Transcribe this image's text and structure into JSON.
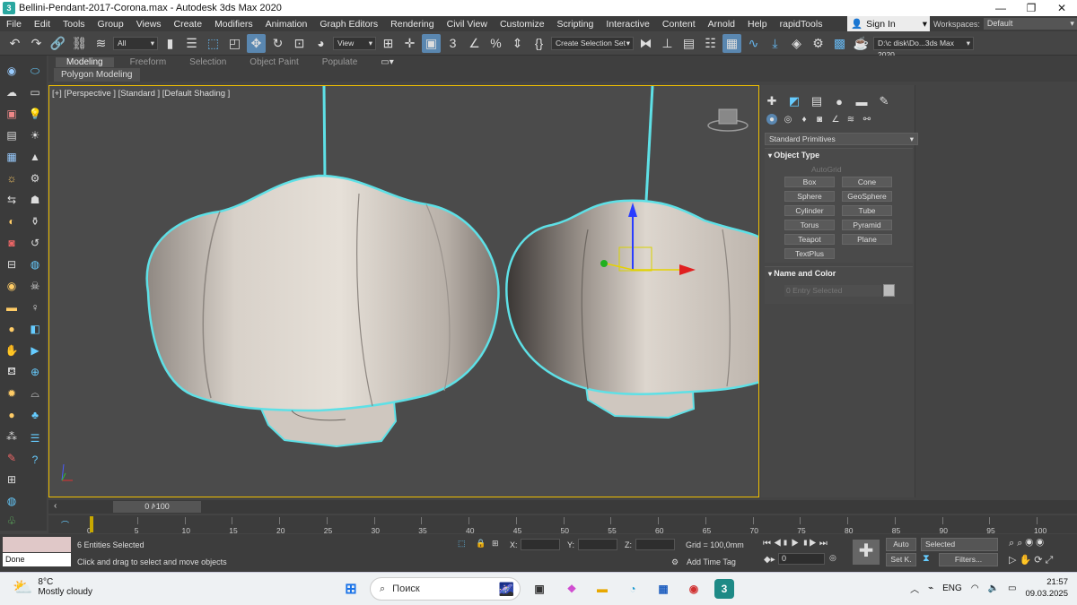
{
  "window": {
    "title": "Bellini-Pendant-2017-Corona.max - Autodesk 3ds Max 2020",
    "min": "—",
    "max": "❐",
    "close": "✕"
  },
  "menu": [
    "File",
    "Edit",
    "Tools",
    "Group",
    "Views",
    "Create",
    "Modifiers",
    "Animation",
    "Graph Editors",
    "Rendering",
    "Civil View",
    "Customize",
    "Scripting",
    "Interactive",
    "Content",
    "Arnold",
    "Help",
    "rapidTools"
  ],
  "signin": {
    "label": "Sign In"
  },
  "workspace": {
    "label": "Workspaces:",
    "value": "Default"
  },
  "toolbar": {
    "selection_filter": "All",
    "ref_coord": "View",
    "named_selection": "Create Selection Set",
    "project_path": "D:\\c disk\\Do...3ds Max 2020"
  },
  "ribbon": {
    "tabs": [
      "Modeling",
      "Freeform",
      "Selection",
      "Object Paint",
      "Populate"
    ],
    "sub": "Polygon Modeling"
  },
  "viewport": {
    "label": "[+] [Perspective ] [Standard ] [Default Shading ]"
  },
  "cmdpanel": {
    "dropdown": "Standard Primitives",
    "object_type": {
      "header": "Object Type",
      "autogrid": "AutoGrid",
      "buttons": [
        "Box",
        "Cone",
        "Sphere",
        "GeoSphere",
        "Cylinder",
        "Tube",
        "Torus",
        "Pyramid",
        "Teapot",
        "Plane",
        "TextPlus"
      ]
    },
    "name_color": {
      "header": "Name and Color",
      "placeholder": "0 Entry Selected"
    }
  },
  "timeslider": {
    "value": "0 / 100"
  },
  "ruler": {
    "ticks": [
      "0",
      "5",
      "10",
      "15",
      "20",
      "25",
      "30",
      "35",
      "40",
      "45",
      "50",
      "55",
      "60",
      "65",
      "70",
      "75",
      "80",
      "85",
      "90",
      "95",
      "100"
    ]
  },
  "status": {
    "maxscript_done": "Done",
    "entities": "6 Entities Selected",
    "prompt": "Click and drag to select and move objects",
    "x_label": "X:",
    "y_label": "Y:",
    "z_label": "Z:",
    "grid": "Grid = 100,0mm",
    "add_time_tag": "Add Time Tag",
    "auto": "Auto",
    "selected": "Selected",
    "setk": "Set K.",
    "filters": "Filters...",
    "frame": "0"
  },
  "taskbar": {
    "temp": "8°C",
    "weather": "Mostly cloudy",
    "search": "Поиск",
    "lang": "ENG",
    "time": "21:57",
    "date": "09.03.2025"
  },
  "colors": {
    "selection_outline": "#5ee0e6",
    "accent": "#5a87b0",
    "viewport_border": "#f0c000"
  }
}
